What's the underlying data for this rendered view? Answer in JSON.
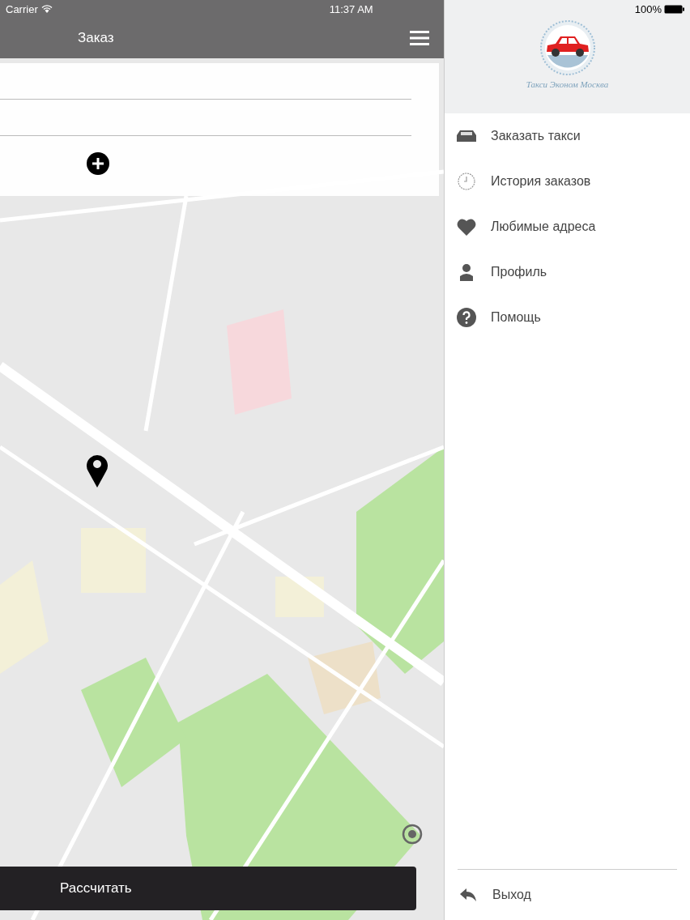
{
  "status_bar": {
    "carrier": "Carrier",
    "time": "11:37 AM",
    "battery": "100%"
  },
  "nav": {
    "title": "Заказ"
  },
  "calculate_button": "Рассчитать",
  "menu": {
    "logo_caption": "Такси Эконом Москва",
    "items": [
      {
        "kind": "car",
        "label": "Заказать такси"
      },
      {
        "kind": "clock",
        "label": "История заказов"
      },
      {
        "kind": "heart",
        "label": "Любимые адреса"
      },
      {
        "kind": "person",
        "label": "Профиль"
      },
      {
        "kind": "help",
        "label": "Помощь"
      }
    ],
    "footer_item": {
      "kind": "back",
      "label": "Выход"
    }
  }
}
